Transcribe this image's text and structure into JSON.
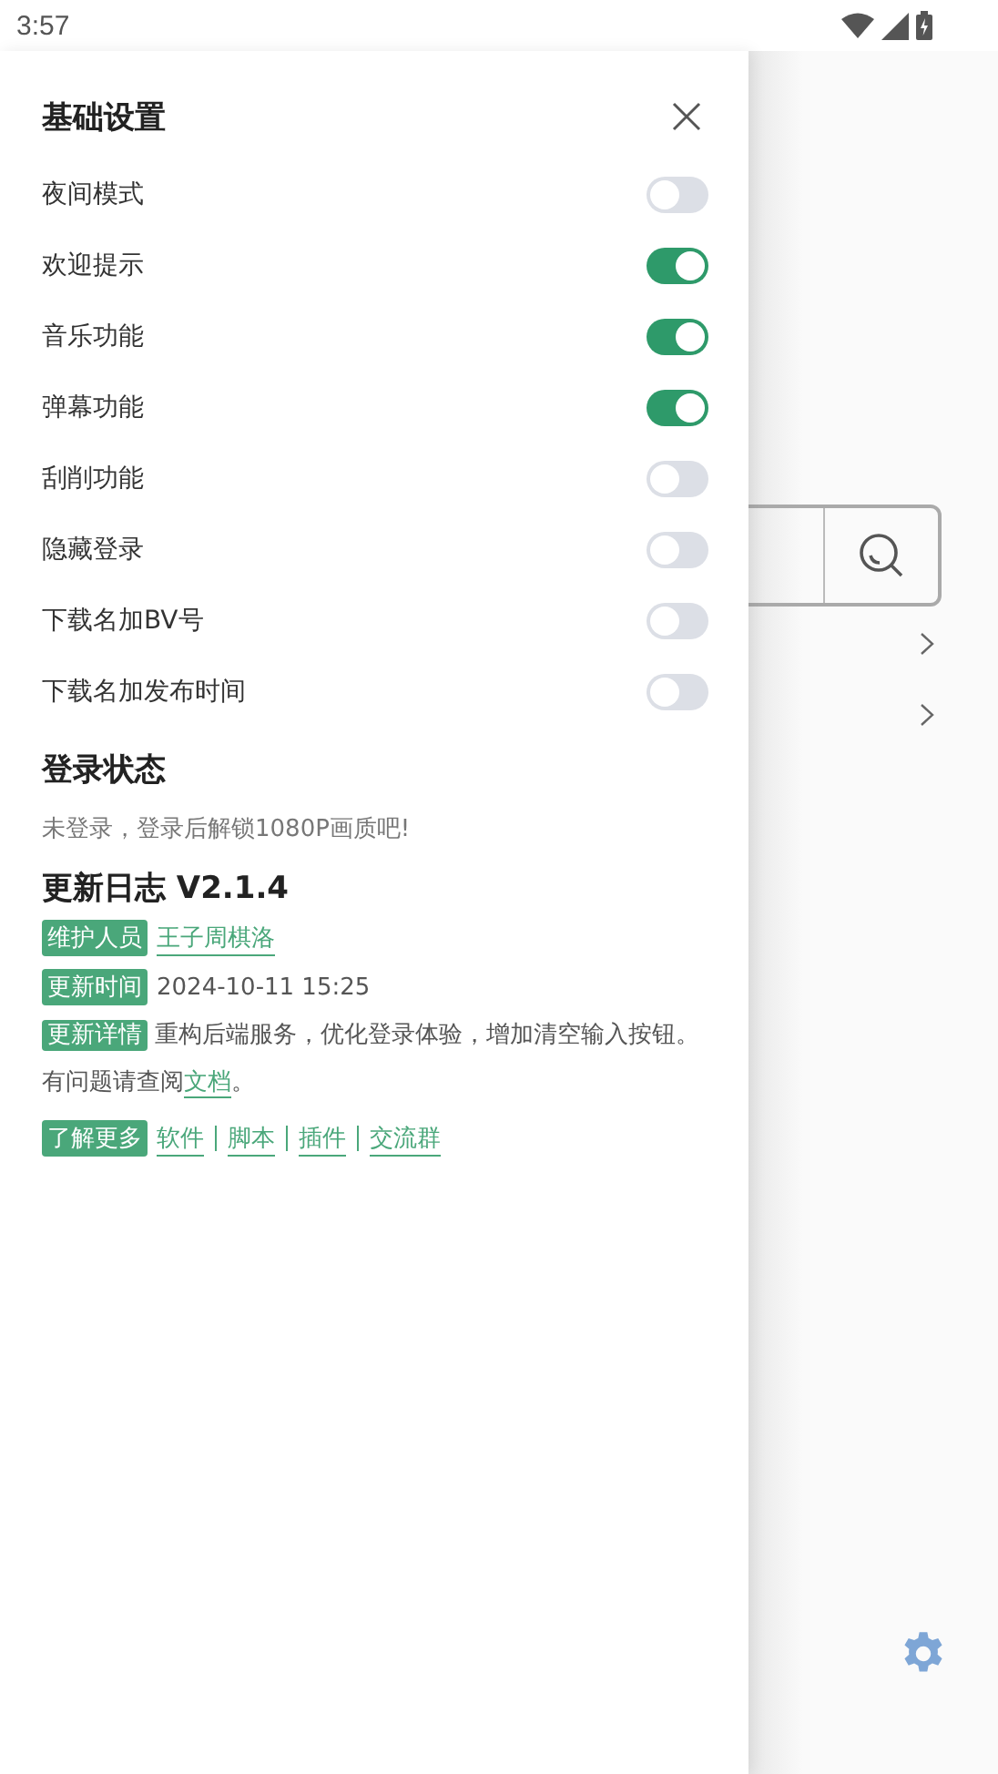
{
  "status_bar": {
    "time": "3:57"
  },
  "drawer": {
    "title": "基础设置",
    "settings": [
      {
        "label": "夜间模式",
        "on": false
      },
      {
        "label": "欢迎提示",
        "on": true
      },
      {
        "label": "音乐功能",
        "on": true
      },
      {
        "label": "弹幕功能",
        "on": true
      },
      {
        "label": "刮削功能",
        "on": false
      },
      {
        "label": "隐藏登录",
        "on": false
      },
      {
        "label": "下载名加BV号",
        "on": false
      },
      {
        "label": "下载名加发布时间",
        "on": false
      }
    ],
    "login": {
      "title": "登录状态",
      "message": "未登录，登录后解锁1080P画质吧!"
    },
    "changelog": {
      "title": "更新日志 V2.1.4",
      "entries": [
        {
          "tag": "维护人员",
          "kind": "link",
          "links": [
            "王子周棋洛"
          ]
        },
        {
          "tag": "更新时间",
          "kind": "text",
          "text": "2024-10-11 15:25"
        },
        {
          "tag": "更新详情",
          "kind": "detail",
          "text": "重构后端服务，优化登录体验，增加清空输入按钮。有问题请查阅",
          "link": "文档",
          "after": "。"
        },
        {
          "tag": "了解更多",
          "kind": "links",
          "links": [
            "软件",
            "脚本",
            "插件",
            "交流群"
          ]
        }
      ]
    }
  }
}
